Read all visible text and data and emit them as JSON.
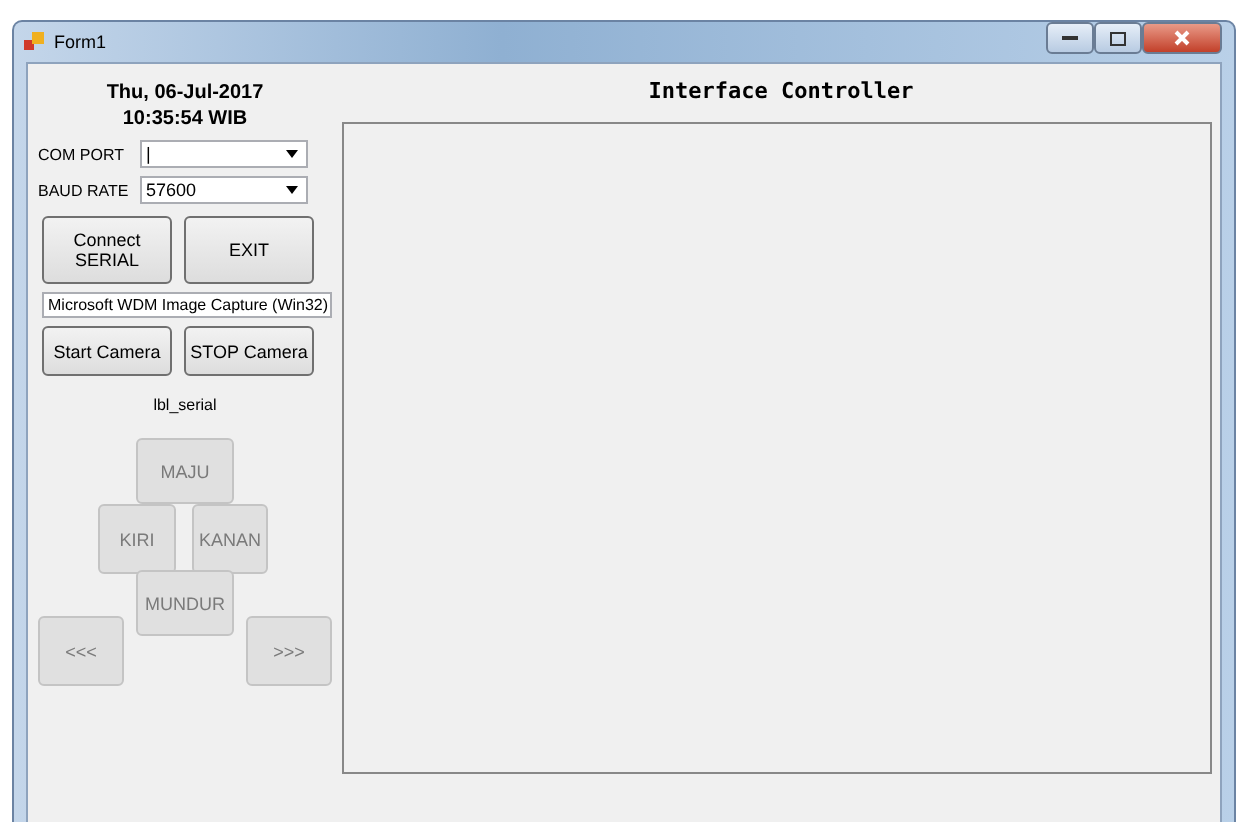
{
  "window": {
    "title": "Form1"
  },
  "date": "Thu, 06-Jul-2017",
  "time": "10:35:54 WIB",
  "heading": "Interface Controller",
  "com_port": {
    "label": "COM PORT",
    "value": "|"
  },
  "baud_rate": {
    "label": "BAUD RATE",
    "value": "57600"
  },
  "buttons": [
    {
      "label": "Connect\nSERIAL",
      "disabled": false
    },
    {
      "label": "EXIT",
      "disabled": false
    }
  ],
  "camera_device": "Microsoft WDM Image Capture (Win32)",
  "camera_buttons": [
    {
      "label": "Start Camera",
      "disabled": false
    },
    {
      "label": "STOP Camera",
      "disabled": false
    }
  ],
  "serial_label": "lbl_serial",
  "direction_buttons": [
    {
      "kind": "up",
      "label": "MAJU",
      "disabled": true
    },
    {
      "kind": "left",
      "label": "KIRI",
      "disabled": true
    },
    {
      "kind": "right",
      "label": "KANAN",
      "disabled": true
    },
    {
      "kind": "down",
      "label": "MUNDUR",
      "disabled": true
    },
    {
      "kind": "prev",
      "label": "<<<",
      "disabled": true
    },
    {
      "kind": "next",
      "label": ">>>",
      "disabled": true
    }
  ]
}
